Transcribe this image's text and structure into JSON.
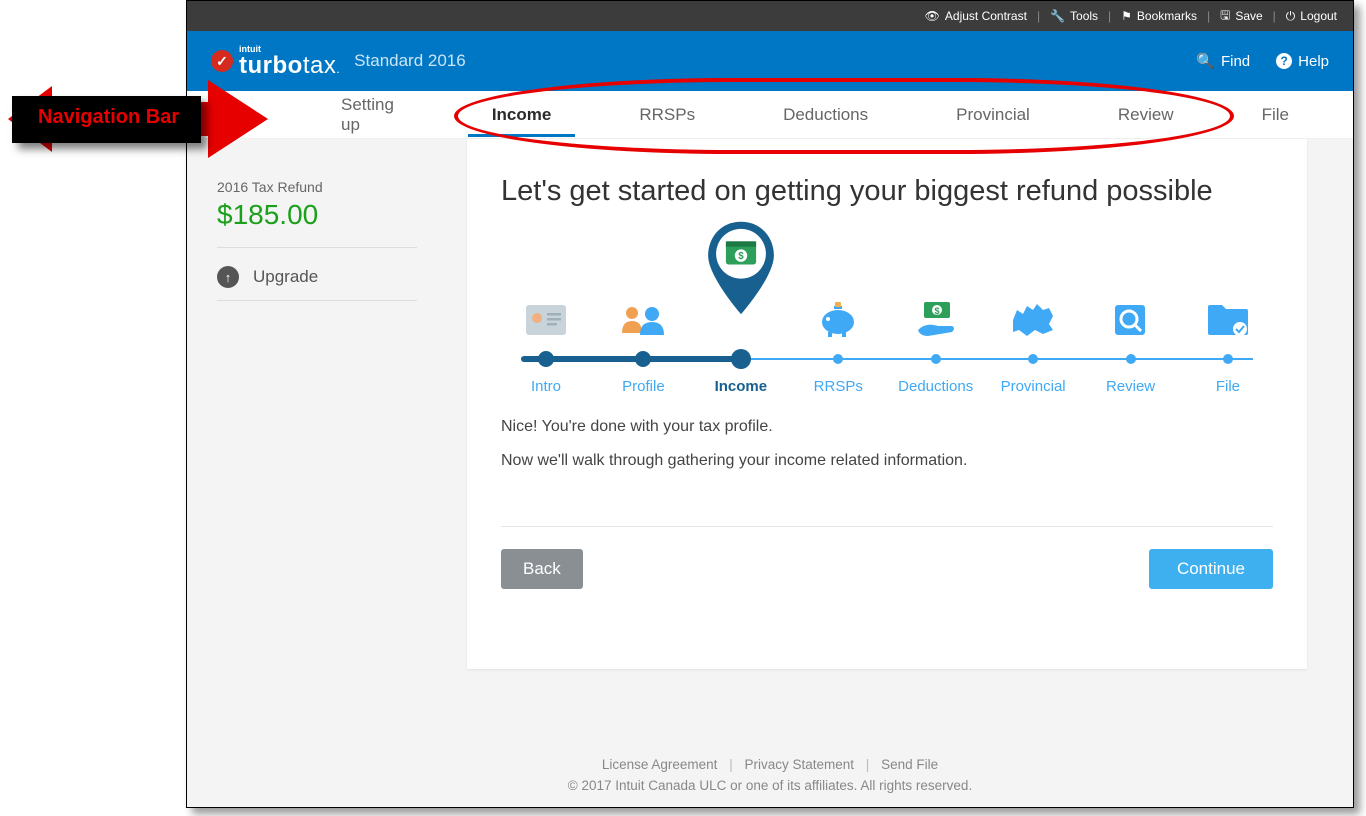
{
  "annotation": {
    "label": "Navigation Bar"
  },
  "darkbar": {
    "contrast": "Adjust Contrast",
    "tools": "Tools",
    "bookmarks": "Bookmarks",
    "save": "Save",
    "logout": "Logout"
  },
  "brand": {
    "intuit": "intuit",
    "name_bold": "turbo",
    "name_rest": "tax",
    "edition": "Standard 2016",
    "find": "Find",
    "help": "Help"
  },
  "tabs": {
    "setting_up": "Setting up",
    "income": "Income",
    "rrsps": "RRSPs",
    "deductions": "Deductions",
    "provincial": "Provincial",
    "review": "Review",
    "file": "File"
  },
  "sidebar": {
    "refund_label": "2016 Tax Refund",
    "refund_amount": "$185.00",
    "upgrade": "Upgrade"
  },
  "main": {
    "heading": "Let's get started on getting your biggest refund possible",
    "steps": {
      "intro": "Intro",
      "profile": "Profile",
      "income": "Income",
      "rrsps": "RRSPs",
      "deductions": "Deductions",
      "provincial": "Provincial",
      "review": "Review",
      "file": "File"
    },
    "line1": "Nice! You're done with your tax profile.",
    "line2": "Now we'll walk through gathering your income related information.",
    "back": "Back",
    "continue": "Continue"
  },
  "footer": {
    "license": "License Agreement",
    "privacy": "Privacy Statement",
    "sendfile": "Send File",
    "copyright": "© 2017 Intuit Canada ULC or one of its affiliates. All rights reserved."
  }
}
